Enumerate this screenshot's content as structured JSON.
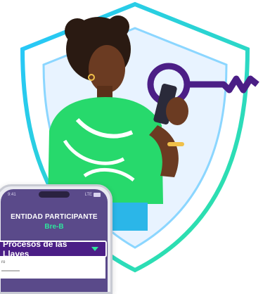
{
  "phone": {
    "status_time": "9:41",
    "status_network": "LTE",
    "entity_title": "ENTIDAD PARTICIPANTE",
    "entity_subtitle": "Bre-B",
    "menu_label": "Procesos de las Llaves",
    "lower_text": "ro"
  },
  "colors": {
    "shield_outline_start": "#27c5ff",
    "shield_outline_end": "#2ee59d",
    "shield_fill": "#e8f3ff",
    "key_purple": "#4b1e86",
    "blouse_green": "#27d96c",
    "skin": "#6b3b22",
    "hair": "#2a1a12",
    "accent_green": "#2ee59d"
  },
  "icons": [
    "shield-icon",
    "key-icon",
    "chevron-down-icon"
  ]
}
